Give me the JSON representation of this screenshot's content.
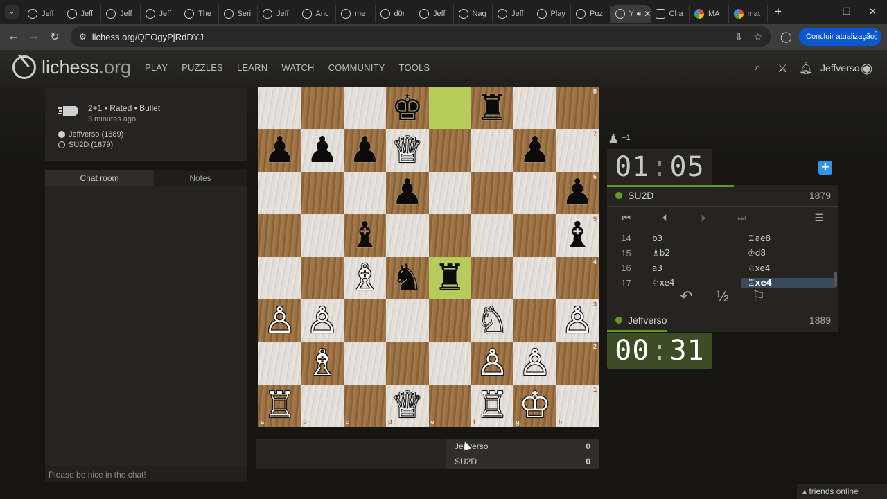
{
  "browser": {
    "tabs": [
      {
        "label": "Jeff",
        "icon": "lichess"
      },
      {
        "label": "Jeff",
        "icon": "lichess"
      },
      {
        "label": "Jeff",
        "icon": "lichess"
      },
      {
        "label": "Jeff",
        "icon": "lichess"
      },
      {
        "label": "The",
        "icon": "lichess"
      },
      {
        "label": "Seri",
        "icon": "lichess"
      },
      {
        "label": "Jeff",
        "icon": "lichess"
      },
      {
        "label": "Anc",
        "icon": "lichess"
      },
      {
        "label": "me",
        "icon": "lichess"
      },
      {
        "label": "d0r",
        "icon": "lichess"
      },
      {
        "label": "Jeff",
        "icon": "lichess"
      },
      {
        "label": "Nag",
        "icon": "lichess"
      },
      {
        "label": "Jeff",
        "icon": "lichess"
      },
      {
        "label": "Play",
        "icon": "lichess"
      },
      {
        "label": "Puz",
        "icon": "lichess"
      },
      {
        "label": "Y",
        "icon": "lichess",
        "active": true
      },
      {
        "label": "Cha",
        "icon": "chatgpt"
      },
      {
        "label": "MA",
        "icon": "google"
      },
      {
        "label": "mat",
        "icon": "google"
      }
    ],
    "url": "lichess.org/QEOgyPjRdDYJ",
    "update_label": "Concluir atualização"
  },
  "site": {
    "logo_main": "lichess",
    "logo_suffix": ".org",
    "nav": [
      "PLAY",
      "PUZZLES",
      "LEARN",
      "WATCH",
      "COMMUNITY",
      "TOOLS"
    ],
    "username": "Jeffverso"
  },
  "game": {
    "type": "2+1 • Rated • Bullet",
    "time_ago": "3 minutes ago",
    "white_player": "Jeffverso (1889)",
    "black_player": "SU2D (1879)"
  },
  "chat": {
    "tab_chat": "Chat room",
    "tab_notes": "Notes",
    "placeholder": "Please be nice in the chat!"
  },
  "board": {
    "files": [
      "a",
      "b",
      "c",
      "d",
      "e",
      "f",
      "g",
      "h"
    ],
    "ranks": [
      "8",
      "7",
      "6",
      "5",
      "4",
      "3",
      "2",
      "1"
    ],
    "highlight_squares": [
      "e8",
      "e4"
    ],
    "pieces": [
      {
        "sq": "d8",
        "color": "b",
        "glyph": "♚"
      },
      {
        "sq": "f8",
        "color": "b",
        "glyph": "♜"
      },
      {
        "sq": "a7",
        "color": "b",
        "glyph": "♟"
      },
      {
        "sq": "b7",
        "color": "b",
        "glyph": "♟"
      },
      {
        "sq": "c7",
        "color": "b",
        "glyph": "♟"
      },
      {
        "sq": "d7",
        "color": "w",
        "glyph": "♕"
      },
      {
        "sq": "g7",
        "color": "b",
        "glyph": "♟"
      },
      {
        "sq": "d6",
        "color": "b",
        "glyph": "♟"
      },
      {
        "sq": "h6",
        "color": "b",
        "glyph": "♟"
      },
      {
        "sq": "c5",
        "color": "b",
        "glyph": "♝"
      },
      {
        "sq": "h5",
        "color": "b",
        "glyph": "♝"
      },
      {
        "sq": "c4",
        "color": "w",
        "glyph": "♗"
      },
      {
        "sq": "d4",
        "color": "b",
        "glyph": "♞"
      },
      {
        "sq": "e4",
        "color": "b",
        "glyph": "♜"
      },
      {
        "sq": "a3",
        "color": "w",
        "glyph": "♙"
      },
      {
        "sq": "b3",
        "color": "w",
        "glyph": "♙"
      },
      {
        "sq": "f3",
        "color": "w",
        "glyph": "♘"
      },
      {
        "sq": "h3",
        "color": "w",
        "glyph": "♙"
      },
      {
        "sq": "b2",
        "color": "w",
        "glyph": "♗"
      },
      {
        "sq": "f2",
        "color": "w",
        "glyph": "♙"
      },
      {
        "sq": "g2",
        "color": "w",
        "glyph": "♙"
      },
      {
        "sq": "a1",
        "color": "w",
        "glyph": "♖"
      },
      {
        "sq": "d1",
        "color": "w",
        "glyph": "♕"
      },
      {
        "sq": "f1",
        "color": "w",
        "glyph": "♖"
      },
      {
        "sq": "g1",
        "color": "w",
        "glyph": "♔"
      }
    ]
  },
  "material": {
    "rows": [
      {
        "name": "Jeffverso",
        "score": "0"
      },
      {
        "name": "SU2D",
        "score": "0"
      }
    ]
  },
  "panel": {
    "advantage": "+1",
    "top_clock_min": "01",
    "top_clock_sec": "05",
    "bottom_clock_min": "00",
    "bottom_clock_sec": "31",
    "top_player": "SU2D",
    "top_rating": "1879",
    "bottom_player": "Jeffverso",
    "bottom_rating": "1889",
    "top_time_fraction": 0.55,
    "bottom_time_fraction": 0.26,
    "moves": [
      {
        "num": "14",
        "white": "b3",
        "black": "♖ae8"
      },
      {
        "num": "15",
        "white": "♗b2",
        "black": "♔d8"
      },
      {
        "num": "16",
        "white": "a3",
        "black": "♘xe4"
      },
      {
        "num": "17",
        "white": "♘xe4",
        "black": "♖xe4",
        "current": "black"
      }
    ],
    "draw_label": "½"
  },
  "footer": {
    "friends": "friends online"
  }
}
